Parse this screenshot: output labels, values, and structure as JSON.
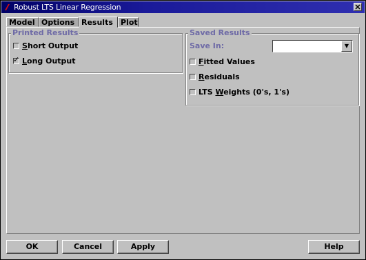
{
  "window": {
    "title": "Robust LTS Linear Regression",
    "close_glyph": "×"
  },
  "tabs": [
    {
      "label": "Model"
    },
    {
      "label": "Options"
    },
    {
      "label": "Results"
    },
    {
      "label": "Plot"
    }
  ],
  "active_tab": "Results",
  "printed_results": {
    "title": "Printed Results",
    "short_output": {
      "label_key": "S",
      "label_rest": "hort Output",
      "checked": false
    },
    "long_output": {
      "label_key": "L",
      "label_rest": "ong Output",
      "checked": true
    }
  },
  "saved_results": {
    "title": "Saved Results",
    "save_in_label": "Save In:",
    "save_in_value": "",
    "fitted_values": {
      "label_key": "F",
      "label_rest": "itted Values",
      "checked": false
    },
    "residuals": {
      "label_key": "R",
      "label_rest": "esiduals",
      "checked": false
    },
    "lts_weights": {
      "label_pre": "LTS ",
      "label_key": "W",
      "label_rest": "eights (0's, 1's)",
      "checked": false
    }
  },
  "buttons": {
    "ok": "OK",
    "cancel": "Cancel",
    "apply": "Apply",
    "help": "Help"
  },
  "icons": {
    "app": "splus-icon",
    "checked_mark": "✓",
    "dropdown": "▼"
  }
}
